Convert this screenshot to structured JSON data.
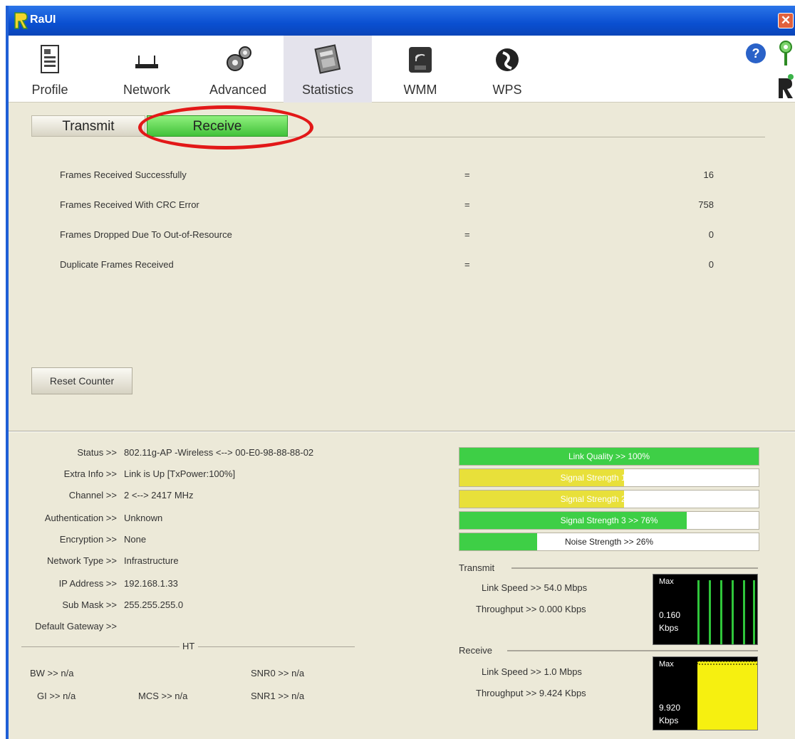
{
  "window": {
    "title": "RaUI",
    "close_glyph": "✕"
  },
  "toolbar": {
    "items": [
      {
        "label": "Profile",
        "icon": "profile-icon"
      },
      {
        "label": "Network",
        "icon": "network-icon"
      },
      {
        "label": "Advanced",
        "icon": "advanced-icon"
      },
      {
        "label": "Statistics",
        "icon": "statistics-icon",
        "active": true
      },
      {
        "label": "WMM",
        "icon": "wmm-icon"
      },
      {
        "label": "WPS",
        "icon": "wps-icon"
      }
    ],
    "help_icon": "help-icon"
  },
  "tabs": {
    "transmit": "Transmit",
    "receive": "Receive",
    "active": "receive"
  },
  "stats": [
    {
      "label": "Frames Received Successfully",
      "sep": "=",
      "value": "16"
    },
    {
      "label": "Frames Received With CRC Error",
      "sep": "=",
      "value": "758"
    },
    {
      "label": "Frames Dropped Due To Out-of-Resource",
      "sep": "=",
      "value": "0"
    },
    {
      "label": "Duplicate Frames Received",
      "sep": "=",
      "value": "0"
    }
  ],
  "reset_button": "Reset Counter",
  "info": {
    "status": {
      "key": "Status >>",
      "value": "802.11g-AP -Wireless <--> 00-E0-98-88-88-02"
    },
    "extra_info": {
      "key": "Extra Info >>",
      "value": "Link is Up [TxPower:100%]"
    },
    "channel": {
      "key": "Channel >>",
      "value": "2 <--> 2417 MHz"
    },
    "authentication": {
      "key": "Authentication >>",
      "value": "Unknown"
    },
    "encryption": {
      "key": "Encryption >>",
      "value": "None"
    },
    "network_type": {
      "key": "Network Type >>",
      "value": "Infrastructure"
    },
    "ip_address": {
      "key": "IP Address >>",
      "value": "192.168.1.33"
    },
    "sub_mask": {
      "key": "Sub Mask >>",
      "value": "255.255.255.0"
    },
    "default_gateway": {
      "key": "Default Gateway >>",
      "value": ""
    }
  },
  "ht": {
    "label": "HT",
    "bw": "BW >> n/a",
    "gi": "GI >> n/a",
    "mcs": "MCS >> n/a",
    "snr0": "SNR0 >> n/a",
    "snr1": "SNR1 >> n/a"
  },
  "bars": [
    {
      "text": "Link Quality >> 100%",
      "level": 100,
      "color": "#3ecf46"
    },
    {
      "text": "Signal Strength 1 >> 55%",
      "level": 55,
      "color": "#e8e03a"
    },
    {
      "text": "Signal Strength 2 >> 55%",
      "level": 55,
      "color": "#e8e03a"
    },
    {
      "text": "Signal Strength 3 >> 76%",
      "level": 76,
      "color": "#3ecf46"
    },
    {
      "text": "Noise Strength >> 26%",
      "level": 26,
      "color": "#3ecf46"
    }
  ],
  "transmit": {
    "label": "Transmit",
    "link_speed": "Link Speed >> 54.0 Mbps",
    "throughput": "Throughput >> 0.000 Kbps",
    "graph_max": "Max",
    "graph_value": "0.160",
    "graph_unit": "Kbps"
  },
  "receive": {
    "label": "Receive",
    "link_speed": "Link Speed >> 1.0 Mbps",
    "throughput": "Throughput >> 9.424 Kbps",
    "graph_max": "Max",
    "graph_value": "9.920",
    "graph_unit": "Kbps"
  },
  "colors": {
    "accent_green": "#42c23a",
    "highlight_red": "#e21818",
    "title_blue": "#0a4fd1"
  }
}
